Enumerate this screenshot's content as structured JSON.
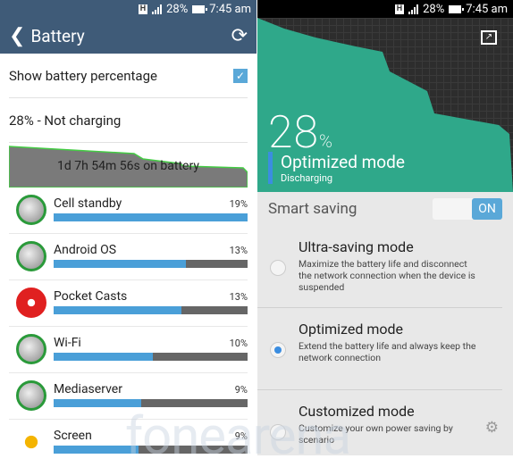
{
  "status": {
    "battery": "28%",
    "time": "7:45 am",
    "network": "H"
  },
  "left": {
    "title": "Battery",
    "show_pct_label": "Show battery percentage",
    "show_pct_checked": true,
    "charge_status": "28% - Not charging",
    "graph_label": "1d 7h 54m 56s on battery",
    "apps": [
      {
        "name": "Cell standby",
        "pct": "19%",
        "value": 100,
        "icon": "signal-icon"
      },
      {
        "name": "Android OS",
        "pct": "13%",
        "value": 68,
        "icon": "android-icon"
      },
      {
        "name": "Pocket Casts",
        "pct": "13%",
        "value": 66,
        "icon": "pocket-casts-icon"
      },
      {
        "name": "Wi-Fi",
        "pct": "10%",
        "value": 51,
        "icon": "wifi-icon"
      },
      {
        "name": "Mediaserver",
        "pct": "9%",
        "value": 45,
        "icon": "media-icon"
      },
      {
        "name": "Screen",
        "pct": "9%",
        "value": 44,
        "icon": "screen-icon"
      }
    ]
  },
  "right": {
    "percent": "28",
    "percent_sign": "%",
    "mode": "Optimized mode",
    "state": "Discharging",
    "smart_label": "Smart saving",
    "toggle": "ON",
    "options": [
      {
        "title": "Ultra-saving mode",
        "desc": "Maximize the battery life and disconnect the network connection when the device is suspended",
        "selected": false
      },
      {
        "title": "Optimized mode",
        "desc": "Extend the battery life and always keep the network connection",
        "selected": true
      },
      {
        "title": "Customized mode",
        "desc": "Customize your own power saving by scenario",
        "selected": false
      }
    ],
    "colors": {
      "chart": "#2fa88a",
      "accent": "#3b8de0"
    }
  },
  "watermark": "fonearena"
}
